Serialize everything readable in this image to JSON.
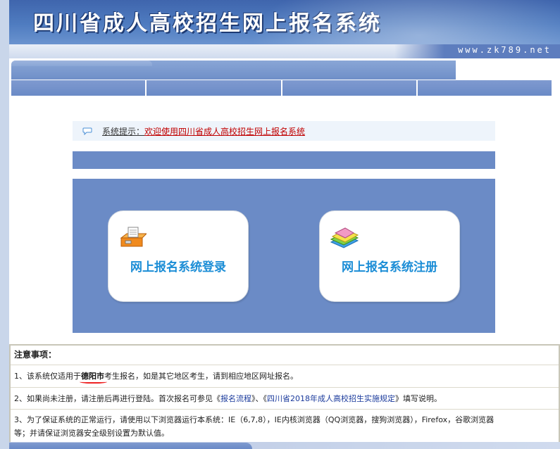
{
  "header": {
    "title": "四川省成人高校招生网上报名系统",
    "site_url": "www.zk789.net"
  },
  "notice": {
    "label": "系统提示：",
    "message": "欢迎使用四川省成人高校招生网上报名系统"
  },
  "cards": {
    "login_label": "网上报名系统登录",
    "register_label": "网上报名系统注册"
  },
  "notes": {
    "heading": "注意事项：",
    "row1": {
      "prefix": "1、该系统仅适用于",
      "city": "德阳市",
      "suffix": "考生报名，如是其它地区考生，请到相应地区网址报名。"
    },
    "row2": {
      "prefix": "2、如果尚未注册，请注册后再进行登陆。首次报名可参见《",
      "link1": "报名流程",
      "middle": "》、《",
      "link2": "四川省2018年成人高校招生实施规定",
      "suffix": "》填写说明。"
    },
    "row3": {
      "line1": "3、为了保证系统的正常运行，请使用以下浏览器运行本系统：IE（6,7,8），IE内核浏览器（QQ浏览器，搜狗浏览器），Firefox，谷歌浏览器",
      "line2": "等；并请保证浏览器安全级别设置为默认值。"
    }
  },
  "colors": {
    "banner": "#3f65ad",
    "panel_blue": "#6b8bc6",
    "card_text": "#1b8dd6",
    "notice_red": "#c00000"
  }
}
